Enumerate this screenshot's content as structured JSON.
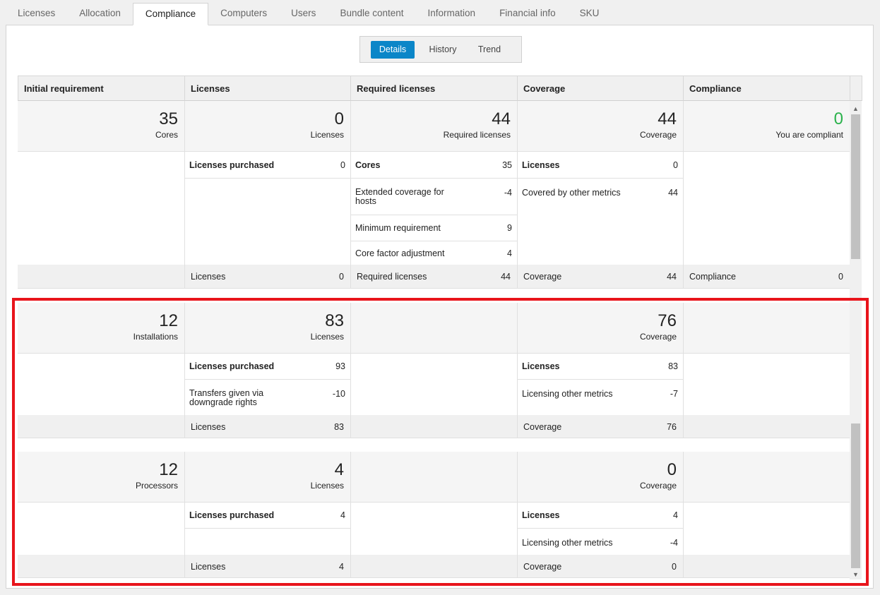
{
  "tabs": [
    "Licenses",
    "Allocation",
    "Compliance",
    "Computers",
    "Users",
    "Bundle content",
    "Information",
    "Financial info",
    "SKU"
  ],
  "active_tab": "Compliance",
  "view_toggle": [
    "Details",
    "History",
    "Trend"
  ],
  "headers": [
    "Initial requirement",
    "Licenses",
    "Required licenses",
    "Coverage",
    "Compliance"
  ],
  "block1": {
    "initial": {
      "value": "35",
      "label": "Cores"
    },
    "licenses": {
      "value": "0",
      "label": "Licenses",
      "rows": [
        {
          "label": "Licenses purchased",
          "value": "0"
        }
      ],
      "footer": {
        "label": "Licenses",
        "value": "0"
      }
    },
    "required": {
      "value": "44",
      "label": "Required licenses",
      "rows": [
        {
          "label": "Cores",
          "value": "35"
        },
        {
          "label": "Extended coverage for hosts",
          "value": "-4"
        },
        {
          "label": "Minimum requirement",
          "value": "9"
        },
        {
          "label": "Core factor adjustment",
          "value": "4"
        }
      ],
      "footer": {
        "label": "Required licenses",
        "value": "44"
      }
    },
    "coverage": {
      "value": "44",
      "label": "Coverage",
      "rows": [
        {
          "label": "Licenses",
          "value": "0"
        },
        {
          "label": "Covered by other metrics",
          "value": "44"
        }
      ],
      "footer": {
        "label": "Coverage",
        "value": "44"
      }
    },
    "compliance": {
      "value": "0",
      "label": "You are compliant",
      "footer": {
        "label": "Compliance",
        "value": "0"
      }
    }
  },
  "block2": {
    "initial": {
      "value": "12",
      "label": "Installations"
    },
    "licenses": {
      "value": "83",
      "label": "Licenses",
      "rows": [
        {
          "label": "Licenses purchased",
          "value": "93"
        },
        {
          "label": "Transfers given via downgrade rights",
          "value": "-10"
        }
      ],
      "footer": {
        "label": "Licenses",
        "value": "83"
      }
    },
    "coverage": {
      "value": "76",
      "label": "Coverage",
      "rows": [
        {
          "label": "Licenses",
          "value": "83"
        },
        {
          "label": "Licensing other metrics",
          "value": "-7"
        }
      ],
      "footer": {
        "label": "Coverage",
        "value": "76"
      }
    }
  },
  "block3": {
    "initial": {
      "value": "12",
      "label": "Processors"
    },
    "licenses": {
      "value": "4",
      "label": "Licenses",
      "rows": [
        {
          "label": "Licenses purchased",
          "value": "4"
        }
      ],
      "footer": {
        "label": "Licenses",
        "value": "4"
      }
    },
    "coverage": {
      "value": "0",
      "label": "Coverage",
      "rows": [
        {
          "label": "Licenses",
          "value": "4"
        },
        {
          "label": "Licensing other metrics",
          "value": "-4"
        }
      ],
      "footer": {
        "label": "Coverage",
        "value": "0"
      }
    }
  },
  "colors": {
    "accent": "#0b86c8",
    "compliant": "#2bb24c",
    "highlight": "#e8141b"
  }
}
